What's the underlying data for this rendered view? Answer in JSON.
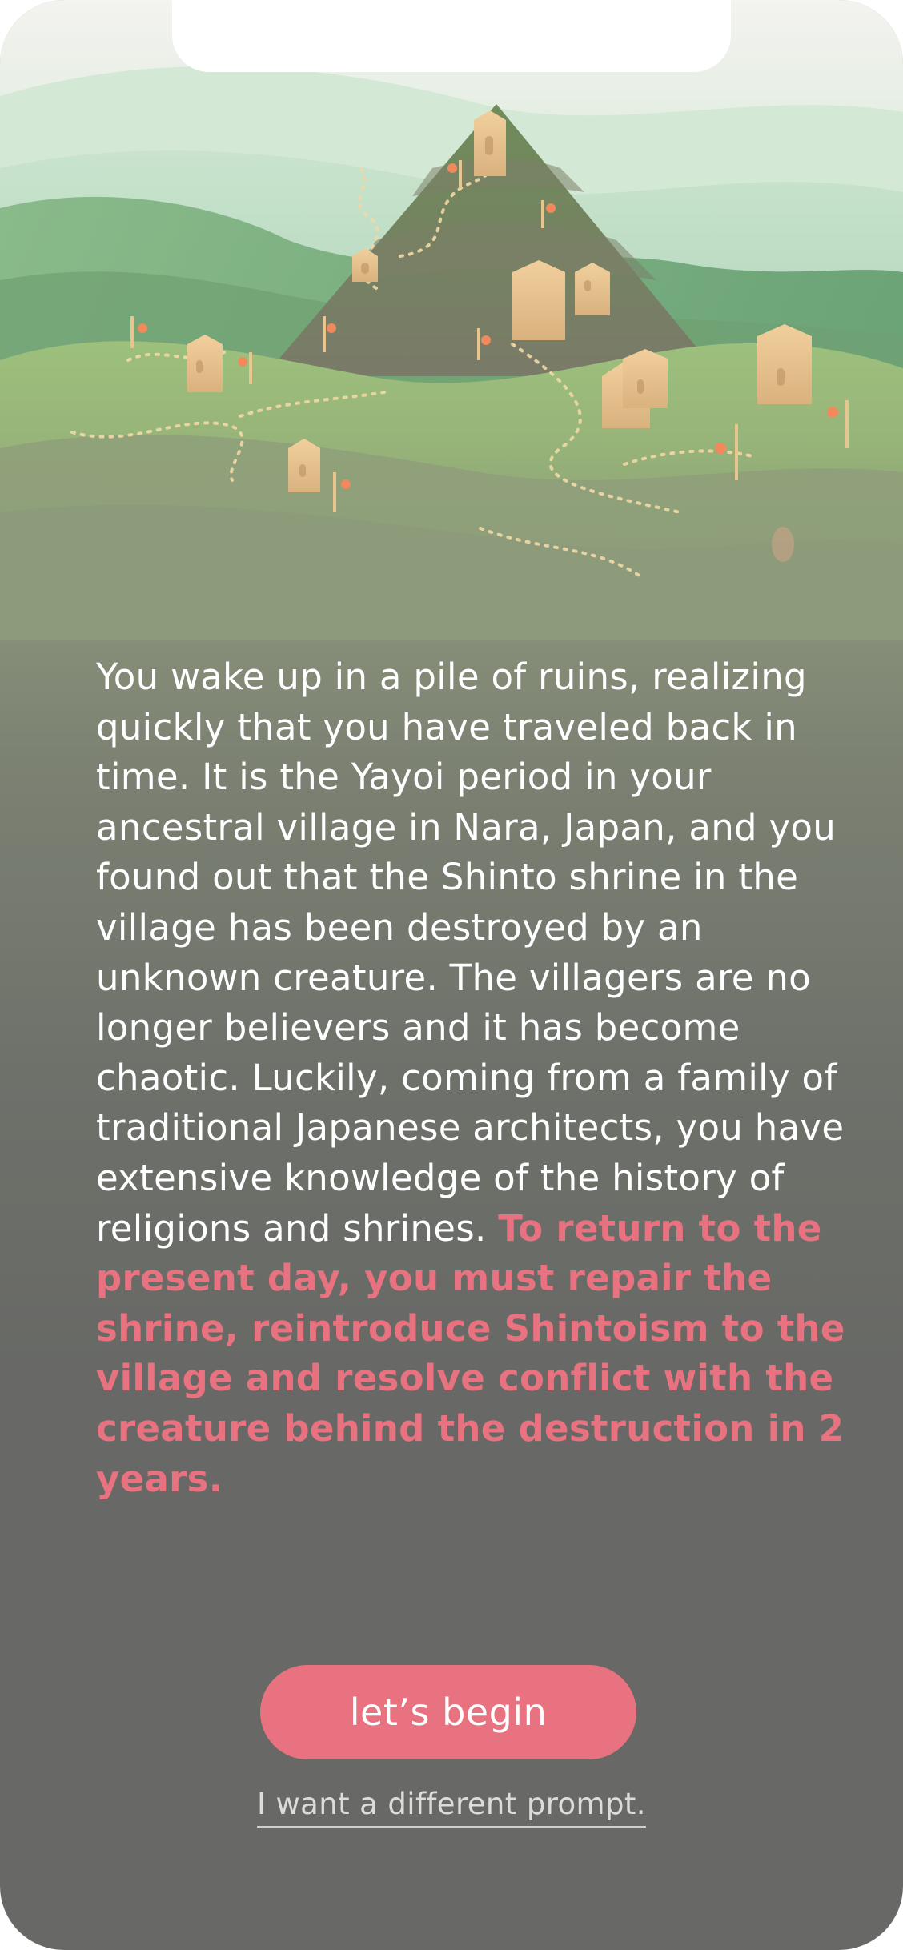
{
  "story": {
    "intro": "You wake up in a pile of ruins, realizing quickly that you have traveled back in time. It is the Yayoi period in your ancestral village in Nara, Japan, and you found out that the Shinto shrine in the village has been destroyed by an unknown creature. The villagers are no longer believers and it has become chaotic. Luckily, coming from a family of traditional Japanese architects, you have extensive knowledge of the history of religions and shrines.",
    "goal": "To return to the present day, you must repair the shrine, reintroduce Shintoism to the village and resolve conflict with the creature behind the destruction in 2 years."
  },
  "actions": {
    "begin_label": "let’s begin",
    "alt_label": "I want a different prompt."
  },
  "colors": {
    "accent": "#e8727f",
    "background": "#686966",
    "text": "#ffffff"
  }
}
